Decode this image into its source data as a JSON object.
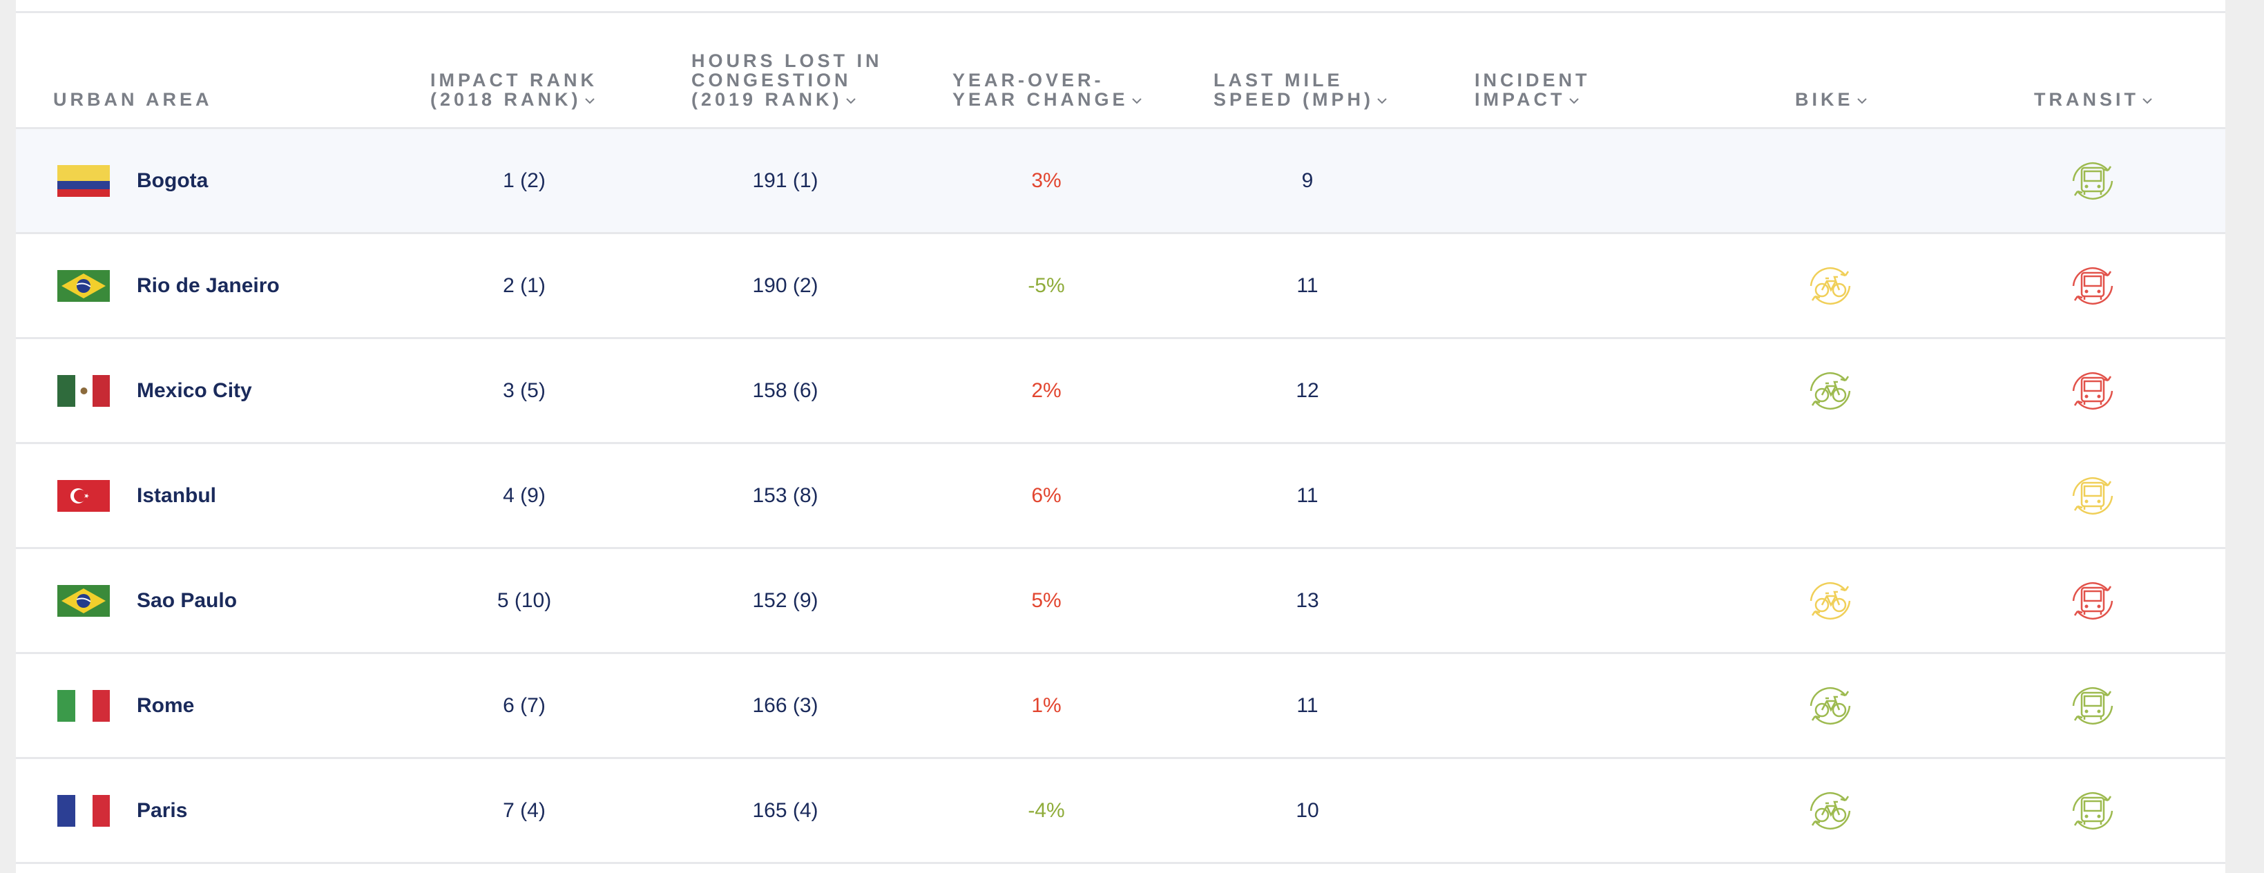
{
  "table": {
    "headers": {
      "urban_area": "URBAN AREA",
      "impact_rank": "IMPACT RANK\n(2018 RANK)",
      "hours_lost": "HOURS LOST IN\nCONGESTION\n(2019 RANK)",
      "yoy_change": "YEAR-OVER-\nYEAR CHANGE",
      "last_mile": "LAST MILE\nSPEED (MPH)",
      "incident": "INCIDENT\nIMPACT",
      "bike": "BIKE",
      "transit": "TRANSIT"
    },
    "rows": [
      {
        "city": "Bogota",
        "flag": "colombia-flag",
        "impact": "1 (2)",
        "hours": "191 (1)",
        "yoy": "3%",
        "yoy_dir": "up",
        "speed": "9",
        "bike": null,
        "transit": "green"
      },
      {
        "city": "Rio de Janeiro",
        "flag": "brazil-flag",
        "impact": "2 (1)",
        "hours": "190 (2)",
        "yoy": "-5%",
        "yoy_dir": "down",
        "speed": "11",
        "bike": "yellow",
        "transit": "red"
      },
      {
        "city": "Mexico City",
        "flag": "mexico-flag",
        "impact": "3 (5)",
        "hours": "158 (6)",
        "yoy": "2%",
        "yoy_dir": "up",
        "speed": "12",
        "bike": "green",
        "transit": "red"
      },
      {
        "city": "Istanbul",
        "flag": "turkey-flag",
        "impact": "4 (9)",
        "hours": "153 (8)",
        "yoy": "6%",
        "yoy_dir": "up",
        "speed": "11",
        "bike": null,
        "transit": "yellow"
      },
      {
        "city": "Sao Paulo",
        "flag": "brazil-flag",
        "impact": "5 (10)",
        "hours": "152 (9)",
        "yoy": "5%",
        "yoy_dir": "up",
        "speed": "13",
        "bike": "yellow",
        "transit": "red"
      },
      {
        "city": "Rome",
        "flag": "italy-flag",
        "impact": "6 (7)",
        "hours": "166 (3)",
        "yoy": "1%",
        "yoy_dir": "up",
        "speed": "11",
        "bike": "green",
        "transit": "green"
      },
      {
        "city": "Paris",
        "flag": "france-flag",
        "impact": "7 (4)",
        "hours": "165 (4)",
        "yoy": "-4%",
        "yoy_dir": "down",
        "speed": "10",
        "bike": "green",
        "transit": "green"
      }
    ]
  },
  "colors": {
    "text": "#1a2a5b",
    "header": "#7b7f87",
    "increase": "#e2452f",
    "decrease": "#8fac3a",
    "icon_green": "#9dba4f",
    "icon_yellow": "#f0cf58",
    "icon_red": "#e2524a"
  }
}
